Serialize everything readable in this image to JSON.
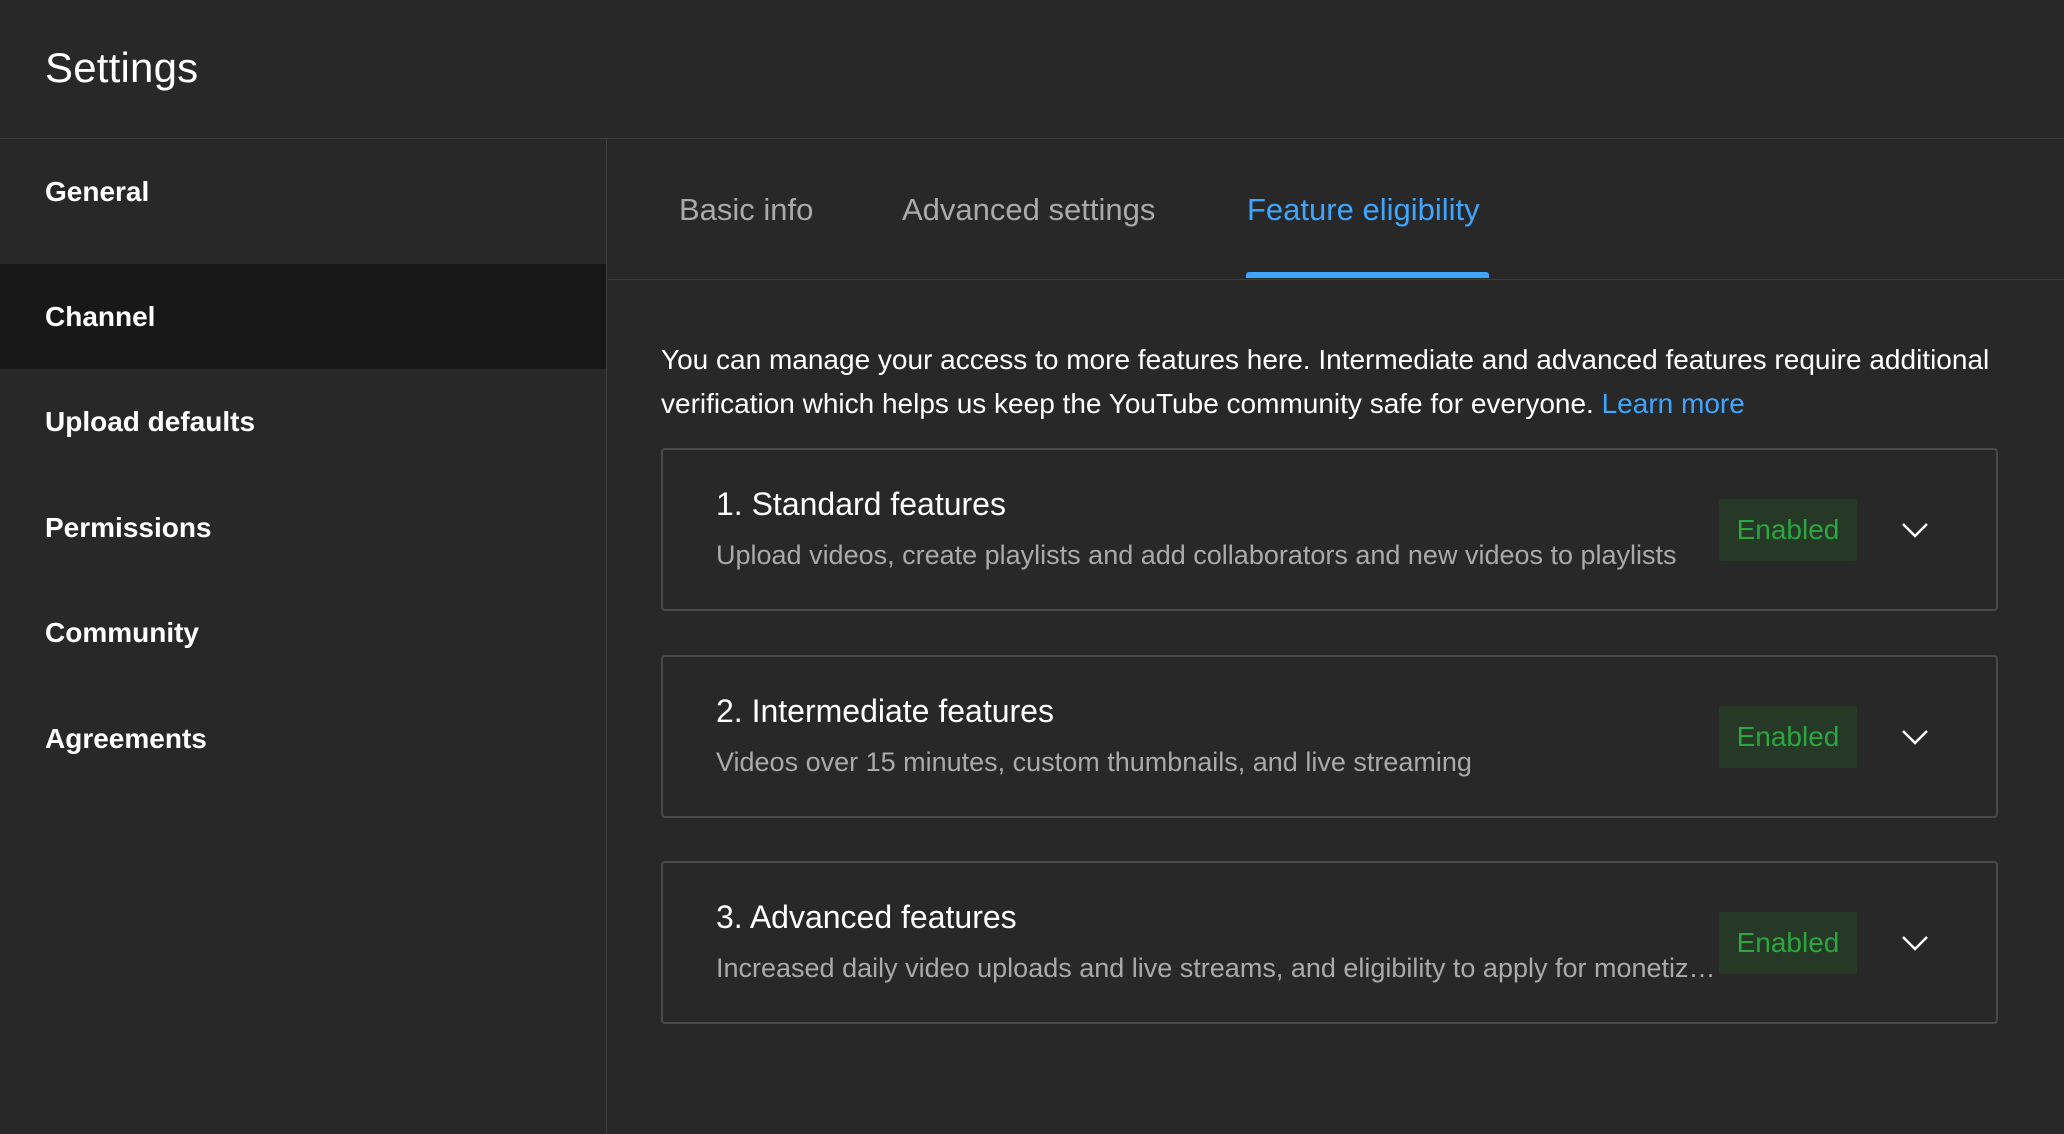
{
  "header": {
    "title": "Settings"
  },
  "sidebar": {
    "items": [
      {
        "label": "General"
      },
      {
        "label": "Channel"
      },
      {
        "label": "Upload defaults"
      },
      {
        "label": "Permissions"
      },
      {
        "label": "Community"
      },
      {
        "label": "Agreements"
      }
    ],
    "active": "Channel"
  },
  "tabs": {
    "items": [
      {
        "label": "Basic info"
      },
      {
        "label": "Advanced settings"
      },
      {
        "label": "Feature eligibility"
      }
    ],
    "active": "Feature eligibility"
  },
  "main": {
    "description": "You can manage your access to more features here. Intermediate and advanced features require additional verification which helps us keep the YouTube community safe for everyone.",
    "learn_more": "Learn more",
    "features": [
      {
        "title": "1. Standard features",
        "description": "Upload videos, create playlists and add collaborators and new videos to playlists",
        "status": "Enabled",
        "expand_icon": "chevron-down-icon"
      },
      {
        "title": "2. Intermediate features",
        "description": "Videos over 15 minutes, custom thumbnails, and live streaming",
        "status": "Enabled",
        "expand_icon": "chevron-down-icon"
      },
      {
        "title": "3. Advanced features",
        "description": "Increased daily video uploads and live streams, and eligibility to apply for monetization",
        "status": "Enabled",
        "expand_icon": "chevron-down-icon"
      }
    ]
  },
  "colors": {
    "background": "#282828",
    "active_sidebar": "#181818",
    "accent": "#3ea6ff",
    "enabled_text": "#2ba640",
    "enabled_bg": "#263826"
  }
}
